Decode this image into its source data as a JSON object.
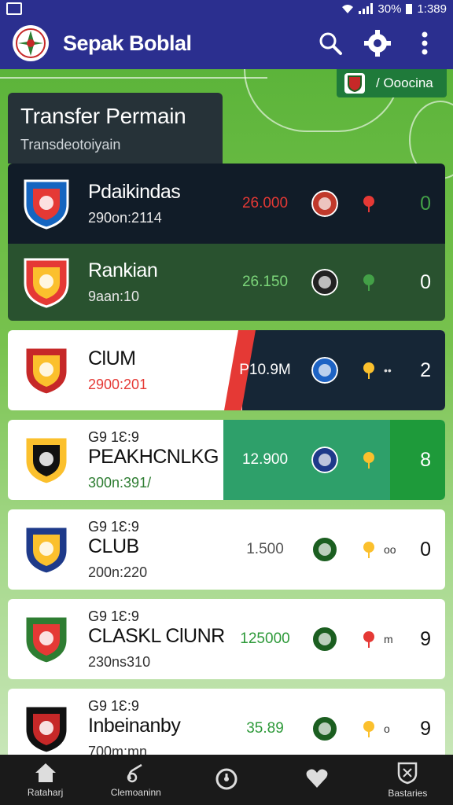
{
  "status": {
    "battery": "30%",
    "time": "1:389"
  },
  "app": {
    "title": "Sepak Boblal"
  },
  "top_chip": {
    "label": "/ Ooocina"
  },
  "section": {
    "title": "Transfer Permain",
    "subtitle": "Transdeotoiyain"
  },
  "transfers": [
    {
      "prefix": "",
      "name": "Pdaikindas",
      "date": "290on:2114",
      "fee": "26.000",
      "score": "0",
      "colors": {
        "crest": "#1565c0",
        "crest2": "#e53935",
        "club2": "#c0392b",
        "mini": "#e53935"
      }
    },
    {
      "prefix": "",
      "name": "Rankian",
      "date": "9aan:10",
      "fee": "26.150",
      "score": "0",
      "colors": {
        "crest": "#e53935",
        "crest2": "#fbc02d",
        "club2": "#222222",
        "mini": "#43a047"
      }
    },
    {
      "prefix": "",
      "name": "ClUM",
      "date": "2900:201",
      "fee": "P10.9M",
      "mini_text": "••",
      "score": "2",
      "colors": {
        "crest": "#c62828",
        "crest2": "#fbc02d",
        "club2": "#1e63c4",
        "mini": "#fbc02d"
      }
    },
    {
      "prefix": "G9 1Ɛ:9",
      "name": "PEAKHCNLKG",
      "date": "300n:391/",
      "fee": "12.900",
      "score": "8",
      "colors": {
        "crest": "#fbc02d",
        "crest2": "#111111",
        "club2": "#1e3a8a",
        "mini": "#fbc02d"
      }
    },
    {
      "prefix": "G9 1Ɛ:9",
      "name": "CLUB",
      "date": "200n:220",
      "fee": "1.500",
      "mini_text": "oo",
      "score": "0",
      "colors": {
        "crest": "#1e3a8a",
        "crest2": "#fbc02d",
        "club2": "#1b5e20",
        "mini": "#fbc02d"
      }
    },
    {
      "prefix": "G9 1Ɛ:9",
      "name": "CLASKL ClUNR",
      "date": "230ns310",
      "fee": "125000",
      "mini_text": "m",
      "score": "9",
      "colors": {
        "crest": "#2e7d32",
        "crest2": "#e53935",
        "club2": "#1b5e20",
        "mini": "#e53935"
      }
    },
    {
      "prefix": "G9 1Ɛ:9",
      "name": "Inbeinanby",
      "date": "700m:mn",
      "fee": "35.89",
      "mini_text": "o",
      "score": "9",
      "colors": {
        "crest": "#111111",
        "crest2": "#c62828",
        "club2": "#1b5e20",
        "mini": "#fbc02d"
      }
    }
  ],
  "bottom_nav": [
    {
      "label": "Rataharj",
      "icon": "home-icon"
    },
    {
      "label": "Clemoaninn",
      "icon": "whistle-icon"
    },
    {
      "label": "",
      "icon": "timer-icon"
    },
    {
      "label": "",
      "icon": "heart-icon"
    },
    {
      "label": "Bastaries",
      "icon": "shield-icon"
    }
  ]
}
